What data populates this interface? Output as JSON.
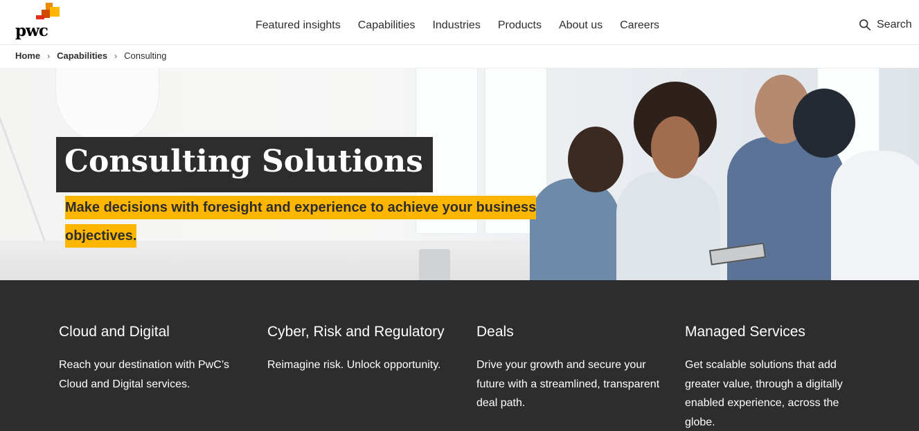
{
  "brand": {
    "logo_text": "pwc",
    "accent": "#ffb600",
    "dark": "#2d2d2d",
    "logo_orange": "#e0301e"
  },
  "nav": {
    "items": [
      "Featured insights",
      "Capabilities",
      "Industries",
      "Products",
      "About us",
      "Careers"
    ],
    "search_label": "Search"
  },
  "breadcrumb": {
    "home": "Home",
    "capabilities": "Capabilities",
    "current": "Consulting"
  },
  "hero": {
    "title": "Consulting Solutions",
    "subtitle": "Make decisions with foresight and experience to achieve your business objectives."
  },
  "services": [
    {
      "title": "Cloud and Digital",
      "description": "Reach your destination with PwC’s Cloud and Digital services."
    },
    {
      "title": "Cyber, Risk and Regulatory",
      "description": "Reimagine risk. Unlock opportunity."
    },
    {
      "title": "Deals",
      "description": "Drive your growth and secure your future with a streamlined, transparent deal path."
    },
    {
      "title": "Managed Services",
      "description": "Get scalable solutions that add greater value, through a digitally enabled experience, across the globe."
    }
  ]
}
